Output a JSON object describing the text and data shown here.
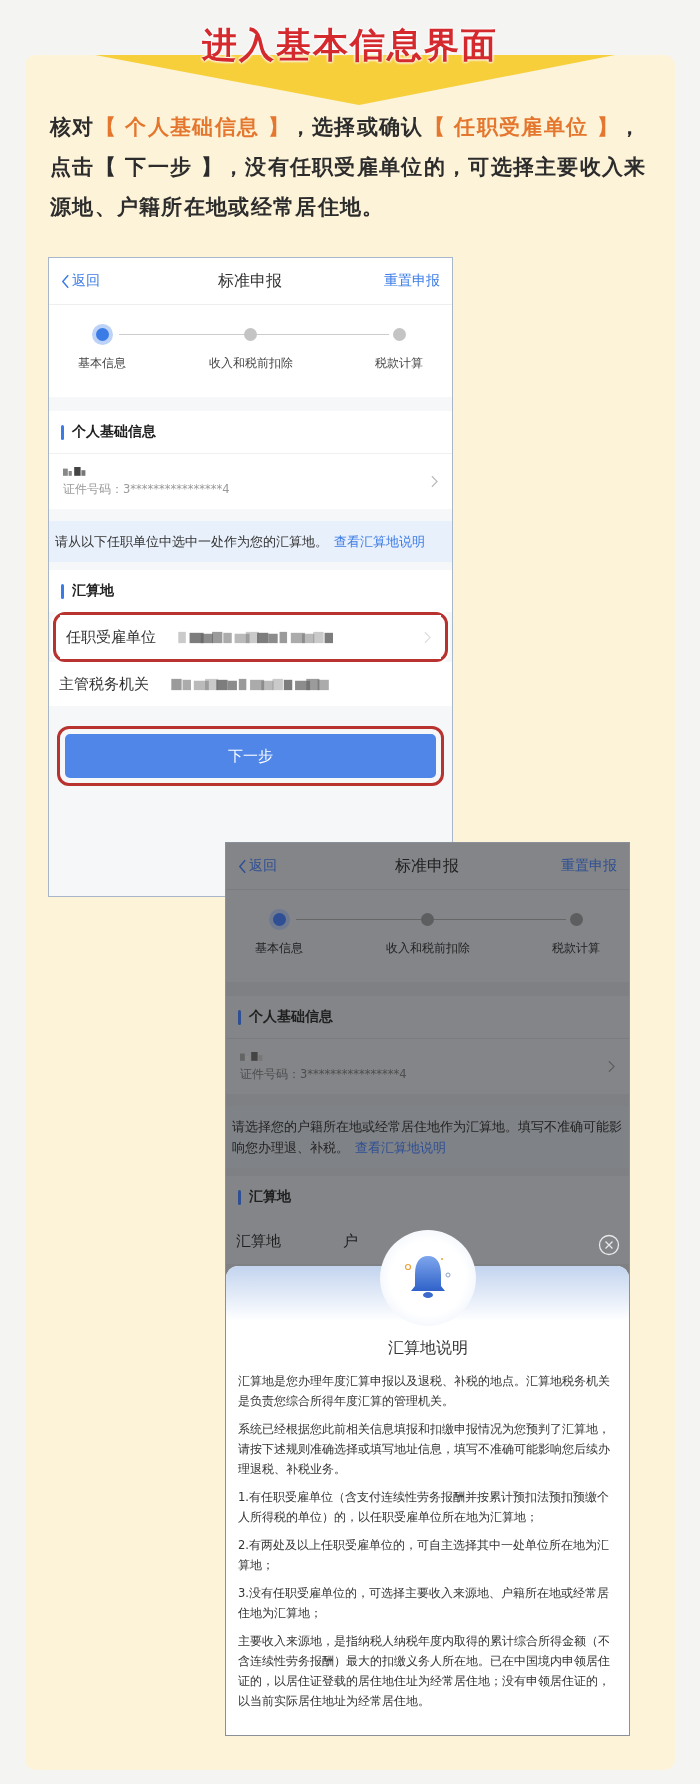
{
  "banner": {
    "title": "进入基本信息界面"
  },
  "instruction": [
    {
      "text": "核对",
      "highlight": false
    },
    {
      "text": "【 个人基础信息 】",
      "highlight": true
    },
    {
      "text": "，选择或确认",
      "highlight": false
    },
    {
      "text": "【 任职受雇单位 】",
      "highlight": true
    },
    {
      "text": "，点击【 下一步 】，没有任职受雇单位的，可选择主要收入来源地、户籍所在地或经常居住地。",
      "highlight": false
    }
  ],
  "phones": [
    {
      "dimmed": false,
      "nav": {
        "back": "返回",
        "title": "标准申报",
        "action": "重置申报"
      },
      "steps": [
        {
          "label": "基本信息",
          "selected": true
        },
        {
          "label": "收入和税前扣除",
          "selected": false
        },
        {
          "label": "税款计算",
          "selected": false
        }
      ],
      "personal_section": {
        "title": "个人基础信息",
        "name_redacted": true,
        "id_text": "证件号码：3****************4"
      },
      "notice": {
        "text": "请从以下任职单位中选中一处作为您的汇算地。",
        "link": "查看汇算地说明"
      },
      "settlement_section": {
        "title": "汇算地",
        "rows": [
          {
            "label": "任职受雇单位",
            "kind": "redacted",
            "highlighted": true,
            "chevron": true
          },
          {
            "label": "主管税务机关",
            "kind": "redacted",
            "highlighted": false,
            "chevron": false
          }
        ]
      },
      "next_button": {
        "label": "下一步",
        "highlighted": true
      }
    },
    {
      "dimmed": true,
      "nav": {
        "back": "返回",
        "title": "标准申报",
        "action": "重置申报"
      },
      "steps": [
        {
          "label": "基本信息",
          "selected": true
        },
        {
          "label": "收入和税前扣除",
          "selected": false
        },
        {
          "label": "税款计算",
          "selected": false
        }
      ],
      "personal_section": {
        "title": "个人基础信息",
        "name_redacted": true,
        "id_text": "证件号码：3****************4"
      },
      "notice": {
        "text": "请选择您的户籍所在地或经常居住地作为汇算地。填写不准确可能影响您办理退、补税。",
        "link": "查看汇算地说明"
      },
      "settlement_section": {
        "title": "汇算地",
        "rows": [
          {
            "label": "汇算地",
            "kind": "text",
            "value": "户",
            "highlighted": false,
            "chevron": false
          }
        ]
      },
      "modal": {
        "title": "汇算地说明",
        "paragraphs": [
          "汇算地是您办理年度汇算申报以及退税、补税的地点。汇算地税务机关是负责您综合所得年度汇算的管理机关。",
          "系统已经根据您此前相关信息填报和扣缴申报情况为您预判了汇算地，请按下述规则准确选择或填写地址信息，填写不准确可能影响您后续办理退税、补税业务。",
          "1.有任职受雇单位（含支付连续性劳务报酬并按累计预扣法预扣预缴个人所得税的单位）的，以任职受雇单位所在地为汇算地；",
          "2.有两处及以上任职受雇单位的，可自主选择其中一处单位所在地为汇算地；",
          "3.没有任职受雇单位的，可选择主要收入来源地、户籍所在地或经常居住地为汇算地；",
          "主要收入来源地，是指纳税人纳税年度内取得的累计综合所得金额（不含连续性劳务报酬）最大的扣缴义务人所在地。已在中国境内申领居住证的，以居住证登载的居住地住址为经常居住地；没有申领居住证的，以当前实际居住地址为经常居住地。"
        ]
      }
    }
  ]
}
